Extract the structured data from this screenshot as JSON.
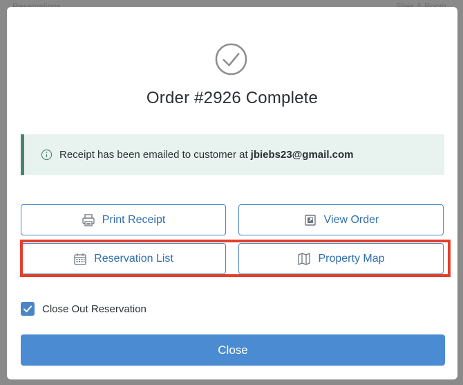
{
  "backdrop": {
    "left_text": "Reservations",
    "right_text": "Sites & Room"
  },
  "modal": {
    "title": "Order #2926 Complete",
    "alert": {
      "message": "Receipt has been emailed to customer at",
      "email": "jbiebs23@gmail.com"
    },
    "buttons": {
      "print_receipt": "Print Receipt",
      "view_order": "View Order",
      "reservation_list": "Reservation List",
      "property_map": "Property Map"
    },
    "close_out": {
      "label": "Close Out Reservation",
      "checked": true
    },
    "close_label": "Close"
  },
  "icons": [
    "check-circle-icon",
    "info-icon",
    "printer-icon",
    "external-link-icon",
    "calendar-icon",
    "map-icon",
    "checkmark-icon"
  ],
  "colors": {
    "accent": "#4a86c5",
    "alert_bg": "#e8f2ee",
    "alert_border": "#4a8470",
    "highlight": "#e2402c"
  }
}
